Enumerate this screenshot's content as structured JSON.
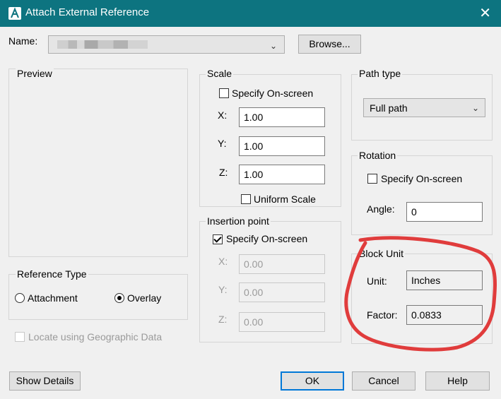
{
  "window": {
    "title": "Attach External Reference",
    "close_icon": "close-icon",
    "app_icon": "autocad-icon"
  },
  "name_row": {
    "label": "Name:",
    "value": "",
    "browse_label": "Browse..."
  },
  "preview": {
    "title": "Preview"
  },
  "reference_type": {
    "title": "Reference Type",
    "options": [
      "Attachment",
      "Overlay"
    ],
    "selected": "Overlay"
  },
  "locate_geo": {
    "label": "Locate using Geographic Data",
    "checked": false,
    "enabled": false
  },
  "scale": {
    "title": "Scale",
    "specify_label": "Specify On-screen",
    "x_label": "X:",
    "y_label": "Y:",
    "z_label": "Z:",
    "x": "1.00",
    "y": "1.00",
    "z": "1.00",
    "uniform_label": "Uniform Scale"
  },
  "insertion": {
    "title": "Insertion point",
    "specify_label": "Specify On-screen",
    "x_label": "X:",
    "y_label": "Y:",
    "z_label": "Z:",
    "x": "0.00",
    "y": "0.00",
    "z": "0.00"
  },
  "path_type": {
    "title": "Path type",
    "selected": "Full path"
  },
  "rotation": {
    "title": "Rotation",
    "specify_label": "Specify On-screen",
    "angle_label": "Angle:",
    "angle": "0"
  },
  "block_unit": {
    "title": "Block Unit",
    "unit_label": "Unit:",
    "unit_value": "Inches",
    "factor_label": "Factor:",
    "factor_value": "0.0833"
  },
  "footer": {
    "show_details": "Show Details",
    "ok": "OK",
    "cancel": "Cancel",
    "help": "Help"
  },
  "colors": {
    "titlebar": "#0d7480",
    "annotation": "#e03c3c",
    "default_button_border": "#0078d7"
  }
}
